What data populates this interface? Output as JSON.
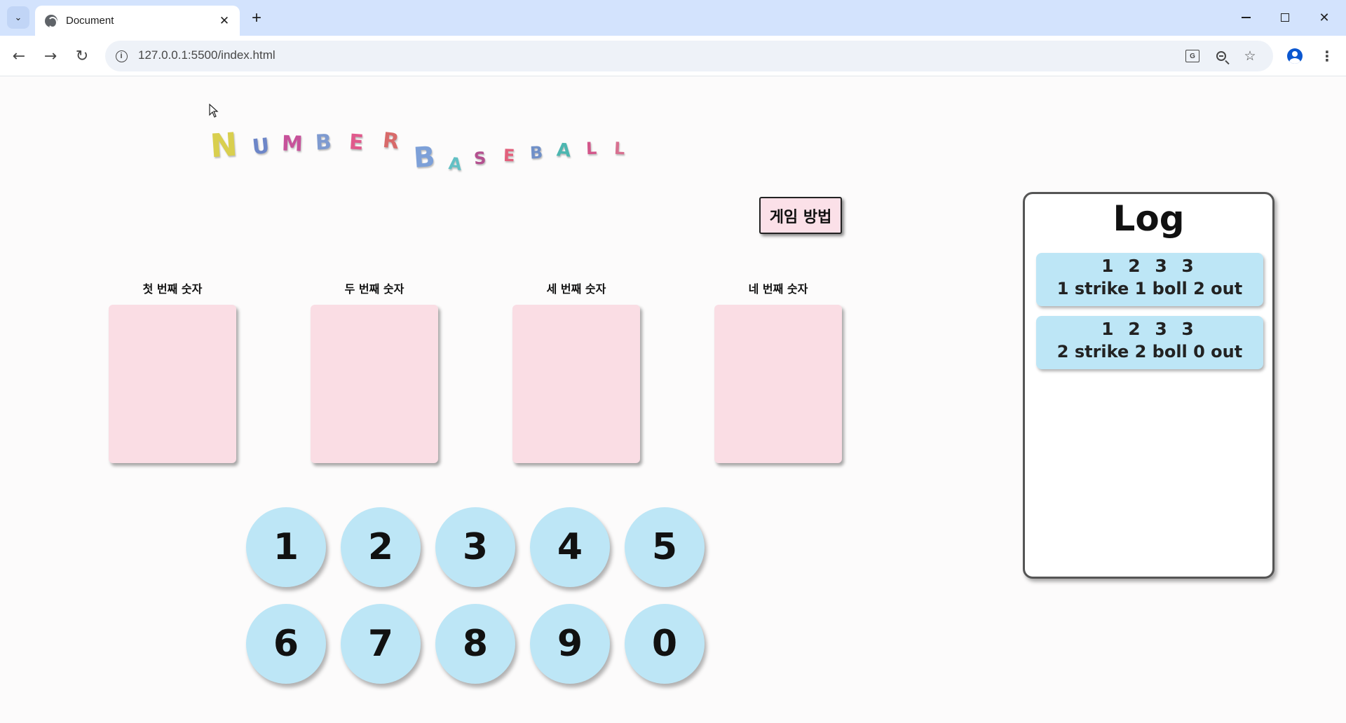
{
  "browser": {
    "tab_title": "Document",
    "url": "127.0.0.1:5500/index.html",
    "new_tab_symbol": "+",
    "tab_close_symbol": "✕",
    "icons": [
      "chevron-down-icon",
      "globe-icon",
      "close-icon",
      "plus-icon",
      "minimize-icon",
      "maximize-icon",
      "close-window-icon",
      "back-arrow-icon",
      "forward-arrow-icon",
      "reload-icon",
      "site-info-icon",
      "translate-icon",
      "zoom-icon",
      "star-icon",
      "profile-icon",
      "more-vertical-icon"
    ]
  },
  "page": {
    "logo": {
      "word1": [
        "N",
        "U",
        "M",
        "B",
        "E",
        "R"
      ],
      "word2": [
        "B",
        "A",
        "S",
        "E",
        "B",
        "A",
        "L",
        "L"
      ]
    },
    "howto_button": "게임 방법",
    "slots": [
      {
        "label": "첫 번째 숫자",
        "value": ""
      },
      {
        "label": "두 번째 숫자",
        "value": ""
      },
      {
        "label": "세 번째 숫자",
        "value": ""
      },
      {
        "label": "네 번째 숫자",
        "value": ""
      }
    ],
    "number_buttons": [
      "1",
      "2",
      "3",
      "4",
      "5",
      "6",
      "7",
      "8",
      "9",
      "0"
    ],
    "log": {
      "title": "Log",
      "entries": [
        {
          "guess": "1 2 3 3",
          "result": "1 strike 1 boll 2 out"
        },
        {
          "guess": "1 2 3 3",
          "result": "2 strike 2 boll 0 out"
        }
      ]
    }
  },
  "colors": {
    "chrome_tab_strip": "#d3e3fd",
    "slot_card": "#fadde4",
    "number_button": "#bde6f6",
    "log_entry": "#bde6f6",
    "howto_button": "#fbe0e8",
    "logo_letters": [
      "#d9cf4e",
      "#6d86c8",
      "#c7519a",
      "#7e9ad0",
      "#e05a8c",
      "#d86a6a",
      "#7da0d8",
      "#62c0c4",
      "#b4508f",
      "#e2607c",
      "#7090c8",
      "#4cb6b0",
      "#d3568a",
      "#d87090"
    ]
  }
}
